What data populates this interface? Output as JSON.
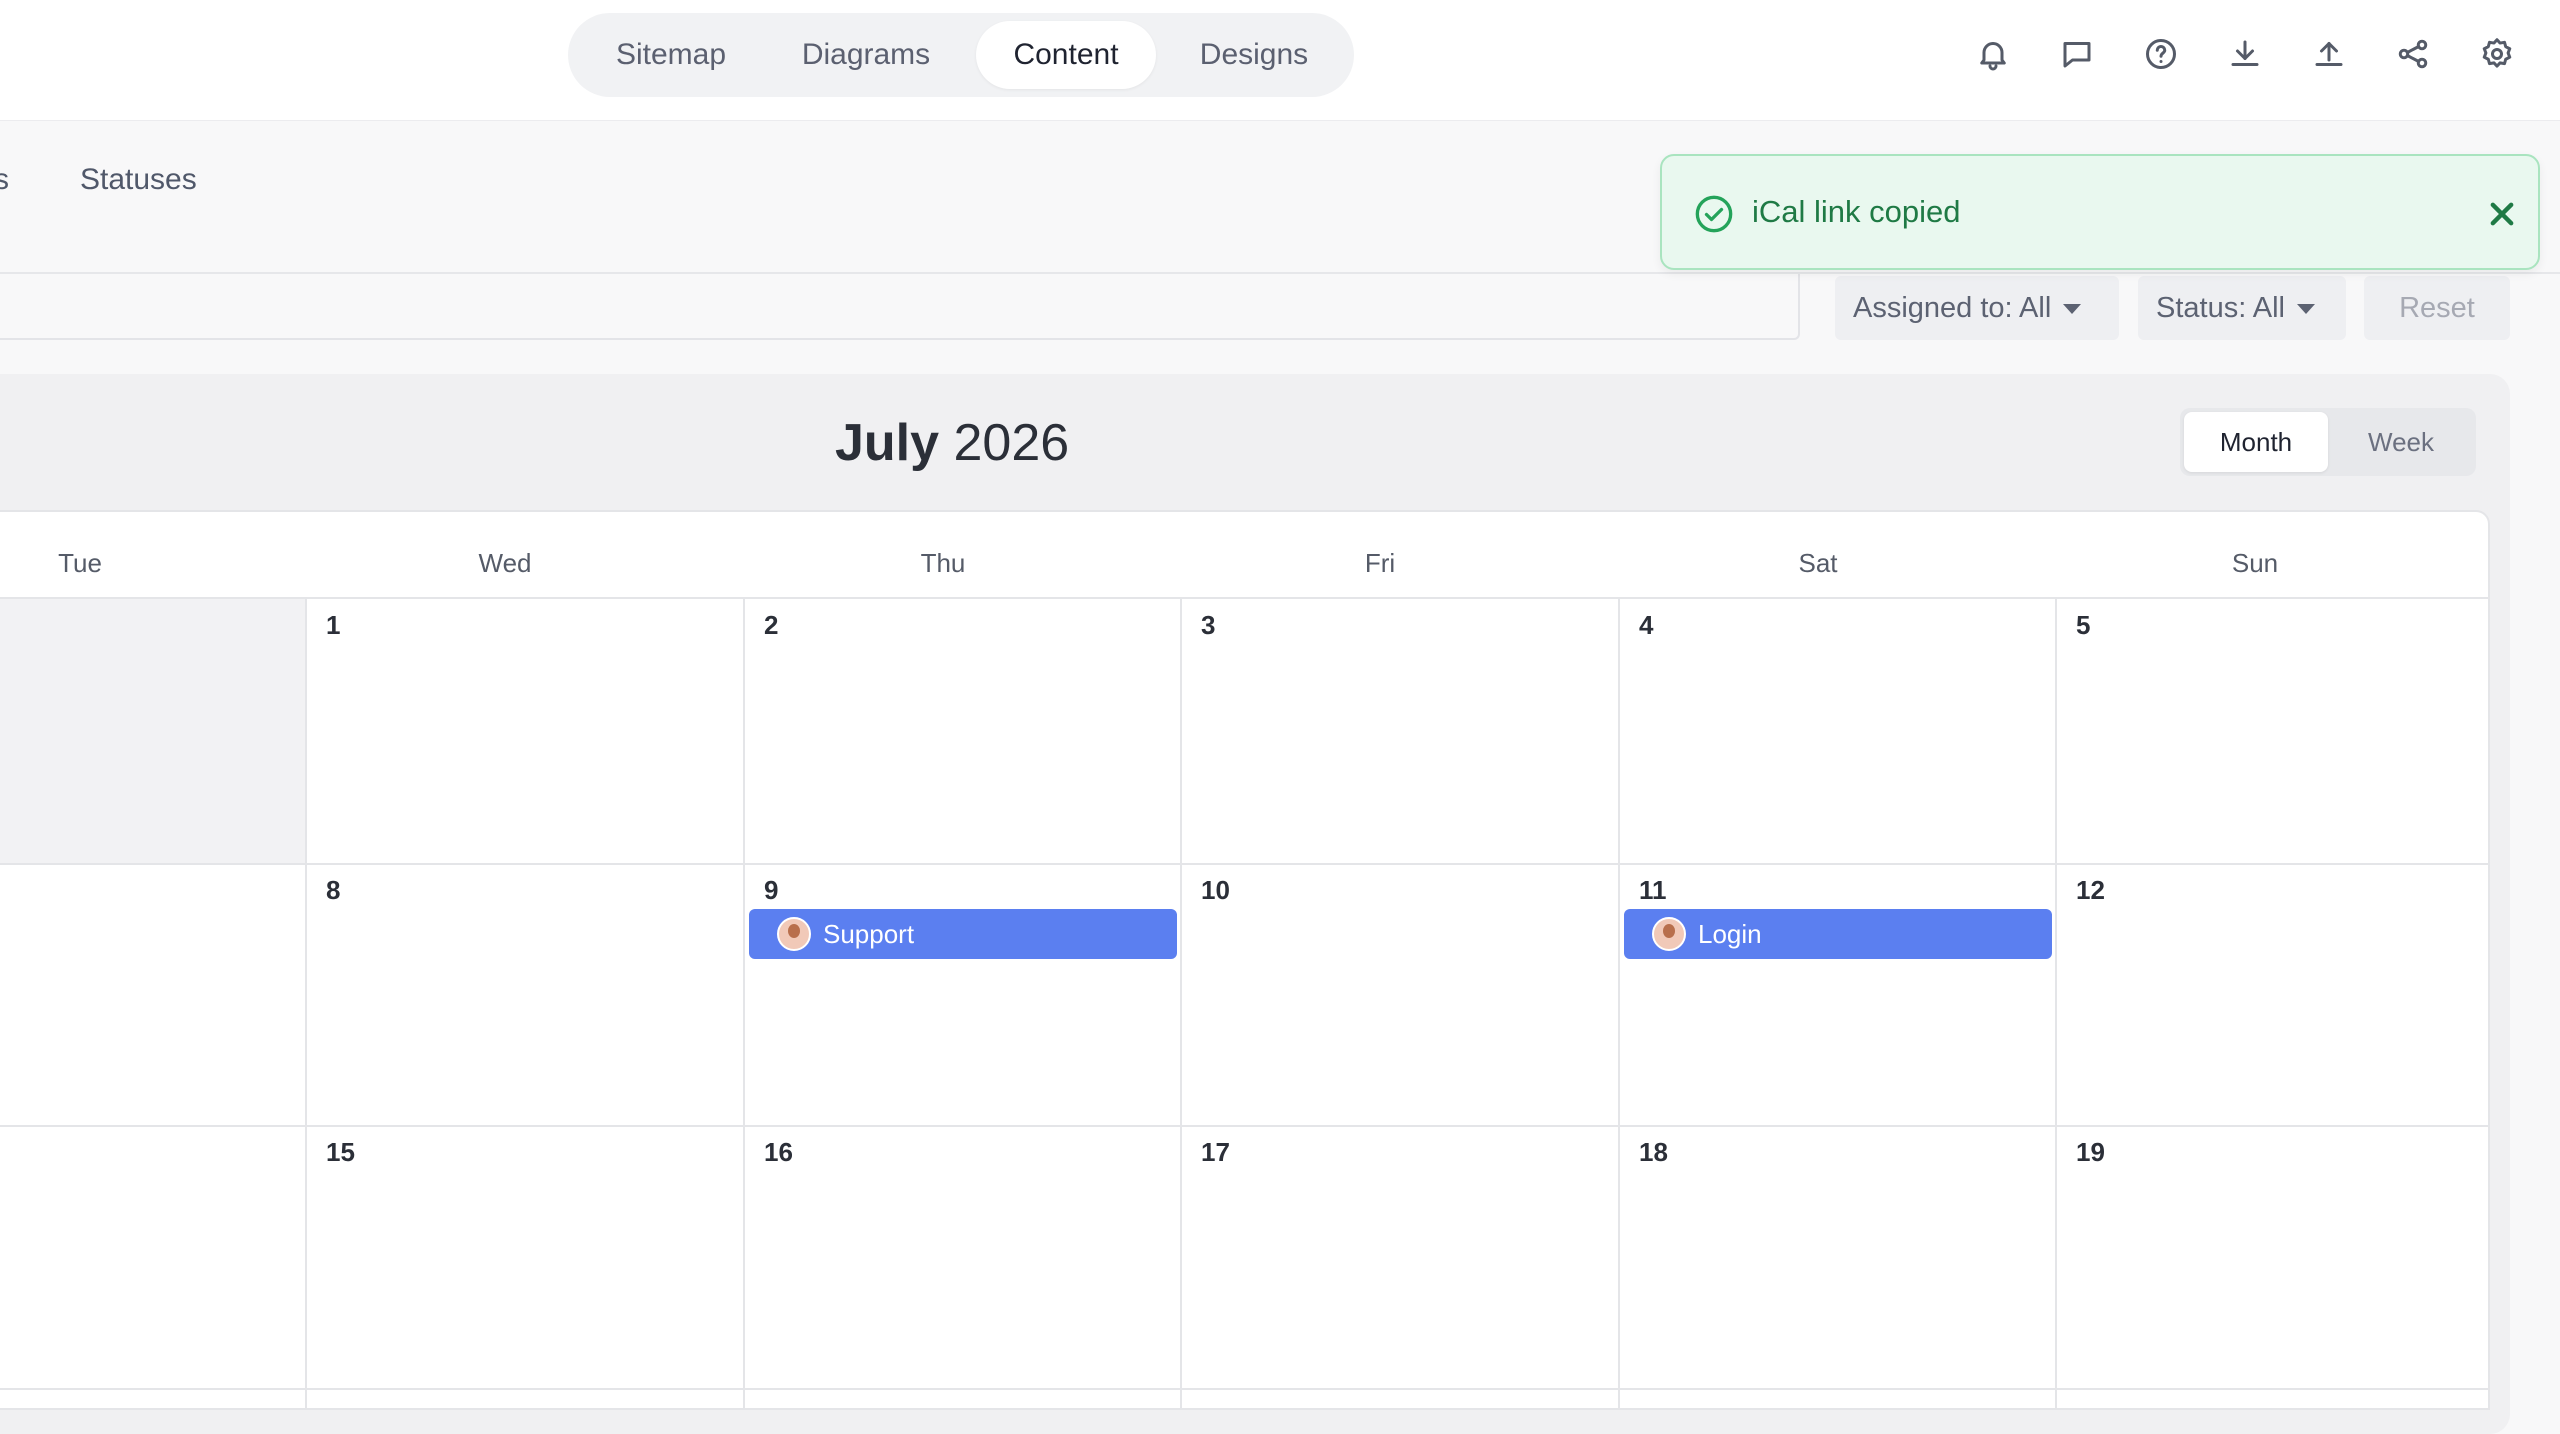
{
  "nav": {
    "tabs": [
      "Sitemap",
      "Diagrams",
      "Content",
      "Designs"
    ],
    "active": "Content"
  },
  "header_icons": [
    "bell-icon",
    "comment-icon",
    "help-icon",
    "download-icon",
    "upload-icon",
    "share-icon",
    "settings-icon"
  ],
  "subtabs": {
    "partial": "s",
    "statuses": "Statuses"
  },
  "filters": {
    "assigned": "Assigned to: All",
    "status": "Status: All",
    "reset": "Reset"
  },
  "toast": {
    "message": "iCal link copied",
    "color": "#1f7a45"
  },
  "calendar": {
    "month": "July",
    "year": "2026",
    "views": {
      "month": "Month",
      "week": "Week",
      "active": "Month"
    },
    "weekdays": [
      "Tue",
      "Wed",
      "Thu",
      "Fri",
      "Sat",
      "Sun"
    ],
    "weeks": [
      [
        "",
        "1",
        "2",
        "3",
        "4",
        "5"
      ],
      [
        "",
        "8",
        "9",
        "10",
        "11",
        "12"
      ],
      [
        "",
        "15",
        "16",
        "17",
        "18",
        "19"
      ]
    ],
    "events": [
      {
        "day": "9",
        "label": "Support"
      },
      {
        "day": "11",
        "label": "Login"
      }
    ],
    "event_color": "#5b7ff0"
  }
}
